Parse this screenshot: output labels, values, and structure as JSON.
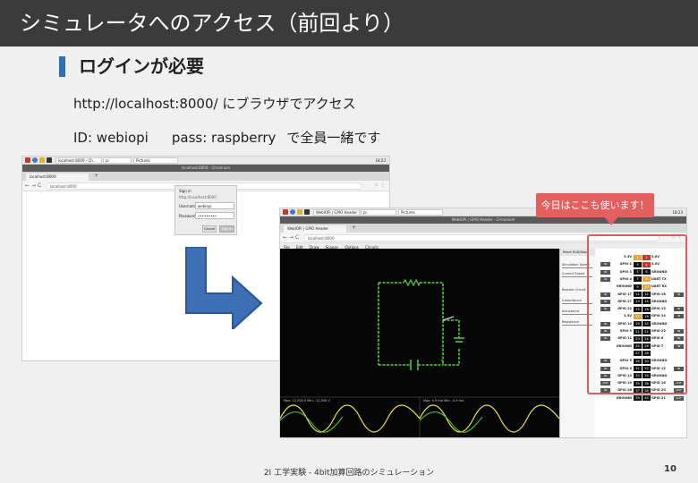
{
  "slide": {
    "title": "シミュレータへのアクセス（前回より）",
    "heading": "ログインが必要",
    "line1": "http://localhost:8000/ にブラウザでアクセス",
    "line2_id": "ID: webiopi",
    "line2_pass": "pass: raspberry",
    "line2_note": "で全員一緒です",
    "callout": "今日はここも使います！",
    "footer": "2I 工学実験 - 4bit加算回路のシミュレーション",
    "page_number": "10",
    "colors": {
      "title_bar": "#3b3b3b",
      "accent_blue": "#2f6db5",
      "callout_red": "#e4605e",
      "arrow_blue": "#3d6fb6"
    }
  },
  "login_shot": {
    "taskbar_tab1": "localhost:8000 - Ch...",
    "taskbar_tab2": "pi",
    "taskbar_tab3": "Pictures",
    "taskbar_clock": "18:23",
    "window_title": "localhost:8000 - Chromium",
    "browser_tab": "localhost:8000",
    "url": "localhost:8000",
    "dialog": {
      "title": "Sign in",
      "host": "http://localhost:8000",
      "username_label": "Username",
      "username_value": "webiopi",
      "password_label": "Password",
      "password_value": "•••••••••",
      "cancel": "Cancel",
      "sign_in": "Sign in"
    }
  },
  "sim_shot": {
    "window_title": "WebIOPi | GPIO Header - Chromium",
    "browser_tab": "WebIOPi | GPIO Header",
    "url": "localhost:8000",
    "menu": [
      "File",
      "Edit",
      "Draw",
      "Scopes",
      "Options",
      "Circuits"
    ],
    "side_tabs": "Reset RUN/Stop",
    "side_items": [
      "Simulation Speed",
      "Current Speed",
      "Resistor Circuit",
      "Capacitance",
      "Inductance",
      "Resistance"
    ],
    "scope_left": "Max: 12.000 V  Min: -12.000 V",
    "scope_right": "Max: 4.9 mA  Min: -4.9 mA",
    "gpio_rows": [
      {
        "l": "3.3V",
        "lp": "1",
        "rp": "2",
        "r": "5.0V",
        "bl": "",
        "br": ""
      },
      {
        "l": "GPIO 2",
        "lp": "3",
        "rp": "4",
        "r": "5.0V",
        "bl": "IN",
        "br": ""
      },
      {
        "l": "GPIO 3",
        "lp": "5",
        "rp": "6",
        "r": "GROUND",
        "bl": "IN",
        "br": ""
      },
      {
        "l": "GPIO 4",
        "lp": "7",
        "rp": "8",
        "r": "UART TX",
        "bl": "IN",
        "br": ""
      },
      {
        "l": "GROUND",
        "lp": "9",
        "rp": "10",
        "r": "UART RX",
        "bl": "",
        "br": ""
      },
      {
        "l": "GPIO 17",
        "lp": "11",
        "rp": "12",
        "r": "GPIO 18",
        "bl": "IN",
        "br": "IN"
      },
      {
        "l": "GPIO 27",
        "lp": "13",
        "rp": "14",
        "r": "GROUND",
        "bl": "IN",
        "br": ""
      },
      {
        "l": "GPIO 22",
        "lp": "15",
        "rp": "16",
        "r": "GPIO 23",
        "bl": "IN",
        "br": "IN"
      },
      {
        "l": "3.3V",
        "lp": "17",
        "rp": "18",
        "r": "GPIO 24",
        "bl": "",
        "br": "IN"
      },
      {
        "l": "GPIO 10",
        "lp": "19",
        "rp": "20",
        "r": "GROUND",
        "bl": "IN",
        "br": ""
      },
      {
        "l": "GPIO 9",
        "lp": "21",
        "rp": "22",
        "r": "GPIO 25",
        "bl": "IN",
        "br": "IN"
      },
      {
        "l": "GPIO 11",
        "lp": "23",
        "rp": "24",
        "r": "GPIO 8",
        "bl": "IN",
        "br": "IN"
      },
      {
        "l": "GROUND",
        "lp": "25",
        "rp": "26",
        "r": "GPIO 7",
        "bl": "",
        "br": "IN"
      },
      {
        "l": "",
        "lp": "27",
        "rp": "28",
        "r": "",
        "bl": "",
        "br": ""
      },
      {
        "l": "GPIO 5",
        "lp": "29",
        "rp": "30",
        "r": "GROUND",
        "bl": "IN",
        "br": ""
      },
      {
        "l": "GPIO 6",
        "lp": "31",
        "rp": "32",
        "r": "GPIO 12",
        "bl": "IN",
        "br": "IN"
      },
      {
        "l": "GPIO 13",
        "lp": "33",
        "rp": "34",
        "r": "GROUND",
        "bl": "IN",
        "br": ""
      },
      {
        "l": "GPIO 19",
        "lp": "35",
        "rp": "36",
        "r": "GPIO 16",
        "bl": "OUT",
        "br": "OUT"
      },
      {
        "l": "GPIO 26",
        "lp": "37",
        "rp": "38",
        "r": "GPIO 20",
        "bl": "IN",
        "br": "OUT"
      },
      {
        "l": "GROUND",
        "lp": "39",
        "rp": "40",
        "r": "GPIO 21",
        "bl": "",
        "br": "OUT"
      }
    ]
  }
}
